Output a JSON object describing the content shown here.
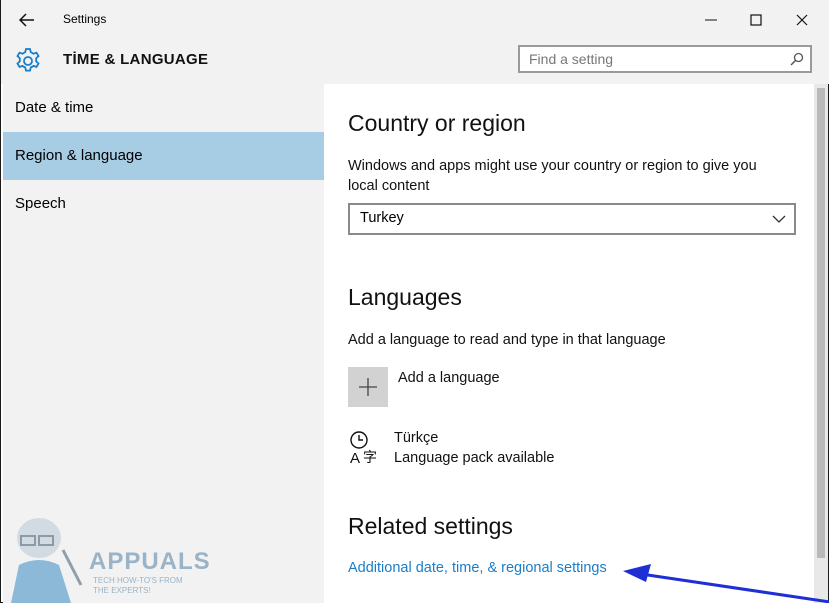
{
  "window": {
    "title": "Settings"
  },
  "header": {
    "section_title": "TİME & LANGUAGE",
    "search_placeholder": "Find a setting"
  },
  "sidebar": {
    "items": [
      {
        "label": "Date & time",
        "active": false
      },
      {
        "label": "Region & language",
        "active": true
      },
      {
        "label": "Speech",
        "active": false
      }
    ]
  },
  "main": {
    "country": {
      "heading": "Country or region",
      "description_line1": "Windows and apps might use your country or region to give you",
      "description_line2": "local content",
      "selected": "Turkey"
    },
    "languages": {
      "heading": "Languages",
      "description": "Add a language to read and type in that language",
      "add_label": "Add a language",
      "items": [
        {
          "name": "Türkçe",
          "status": "Language pack available"
        }
      ]
    },
    "related": {
      "heading": "Related settings",
      "link": "Additional date, time, & regional settings"
    }
  },
  "watermark": {
    "name": "APPUALS",
    "tagline_line1": "TECH HOW-TO'S FROM",
    "tagline_line2": "THE EXPERTS!"
  },
  "colors": {
    "accent": "#1a7ec8",
    "selection": "#a7cde4",
    "arrow": "#1f2fd6"
  },
  "icons": [
    "back-arrow-icon",
    "minimize-icon",
    "maximize-icon",
    "close-icon",
    "gear-icon",
    "search-icon",
    "chevron-down-icon",
    "plus-icon",
    "language-icon"
  ]
}
